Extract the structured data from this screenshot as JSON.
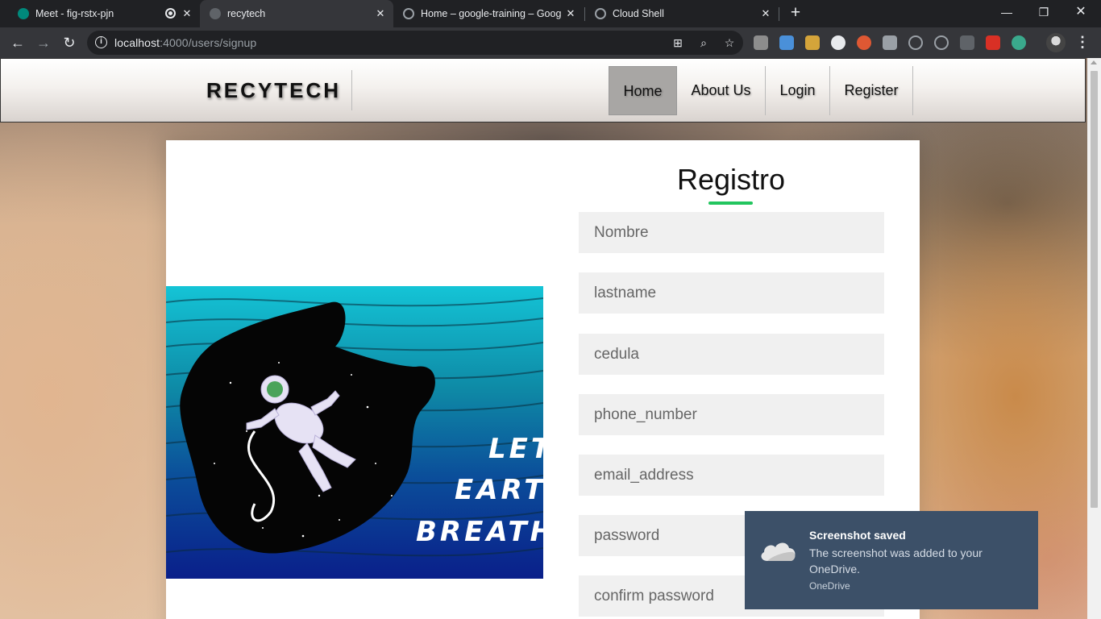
{
  "browser": {
    "tabs": [
      {
        "title": "Meet - fig-rstx-pjn",
        "icon": "google-meet-icon"
      },
      {
        "title": "recytech",
        "icon": "globe-icon"
      },
      {
        "title": "Home – google-training – Googl",
        "icon": "google-cloud-icon"
      },
      {
        "title": "Cloud Shell",
        "icon": "google-cloud-icon"
      }
    ],
    "url_host": "localhost",
    "url_path": ":4000/users/signup"
  },
  "navbar": {
    "brand": "RECYTECH",
    "items": [
      "Home",
      "About Us",
      "Login",
      "Register"
    ],
    "active": "Home"
  },
  "hero": {
    "lines": [
      "LET",
      "EARTH",
      "BREATHE"
    ]
  },
  "form": {
    "title": "Registro",
    "accent_color": "#22c55e",
    "fields": [
      {
        "placeholder": "Nombre"
      },
      {
        "placeholder": "lastname"
      },
      {
        "placeholder": "cedula"
      },
      {
        "placeholder": "phone_number"
      },
      {
        "placeholder": "email_address"
      },
      {
        "placeholder": "password"
      },
      {
        "placeholder": "confirm password"
      }
    ]
  },
  "toast": {
    "title": "Screenshot saved",
    "body": "The screenshot was added to your OneDrive.",
    "app": "OneDrive",
    "icon": "onedrive-cloud-icon"
  }
}
